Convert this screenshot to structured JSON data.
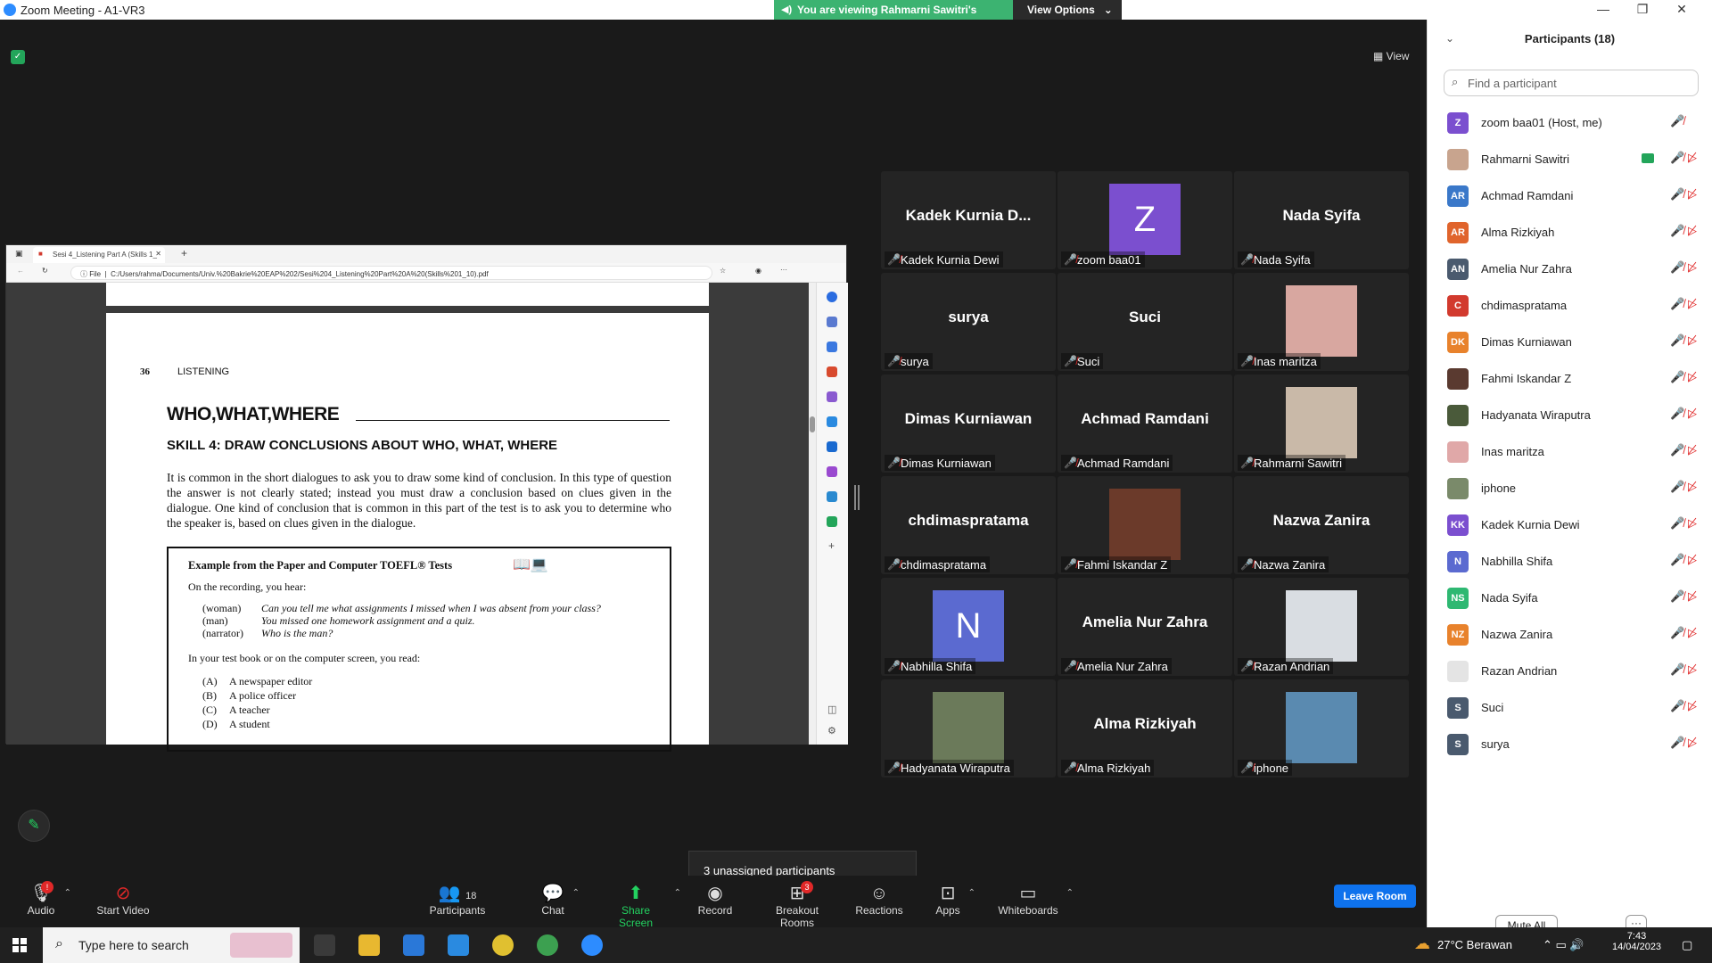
{
  "window": {
    "title": "Zoom Meeting - A1-VR3",
    "min": "—",
    "max": "❐",
    "close": "✕"
  },
  "banner": {
    "text": "You are viewing Rahmarni Sawitri's screen",
    "view_options": "View Options",
    "view": "View"
  },
  "share": {
    "tab_title": "Sesi 4_Listening Part A (Skills 1_",
    "url": "C:/Users/rahma/Documents/Univ.%20Bakrie%20EAP%202/Sesi%204_Listening%20Part%20A%20(Skills%201_10).pdf",
    "file_label": "File",
    "page_number": "36",
    "running_head": "LISTENING",
    "heading": "WHO,WHAT,WHERE",
    "skill": "SKILL 4:   DRAW CONCLUSIONS ABOUT WHO, WHAT, WHERE",
    "paragraph": "It is common in the short dialogues to ask you to draw some kind of conclusion. In this type of question the answer is not clearly stated; instead you must draw a conclusion based on clues given in the dialogue. One kind of conclusion that is common in this part of the test is to ask you to determine who the speaker is, based on clues given in the dialogue.",
    "example_title": "Example from the Paper and Computer TOEFL® Tests",
    "on_recording": "On the recording, you hear:",
    "dialogue": [
      {
        "who": "(woman)",
        "what": "Can you tell me what assignments I missed when I was absent from your class?"
      },
      {
        "who": "(man)",
        "what": "You missed one homework assignment and a quiz."
      },
      {
        "who": "(narrator)",
        "what": "Who is the man?"
      }
    ],
    "read_line": "In your test book or on the computer screen, you read:",
    "options": [
      {
        "key": "(A)",
        "text": "A newspaper editor"
      },
      {
        "key": "(B)",
        "text": "A police officer"
      },
      {
        "key": "(C)",
        "text": "A teacher"
      },
      {
        "key": "(D)",
        "text": "A student"
      }
    ]
  },
  "gallery": [
    {
      "center": "Kadek  Kurnia  D...",
      "label": "Kadek Kurnia Dewi"
    },
    {
      "avatar": "Z",
      "color": "#7b4fcf",
      "label": "zoom baa01"
    },
    {
      "center": "Nada Syifa",
      "label": "Nada Syifa"
    },
    {
      "center": "surya",
      "label": "surya"
    },
    {
      "center": "Suci",
      "label": "Suci"
    },
    {
      "photo": "#d8a7a0",
      "label": "Inas maritza"
    },
    {
      "center": "Dimas Kurniawan",
      "label": "Dimas Kurniawan"
    },
    {
      "center": "Achmad Ramdani",
      "label": "Achmad Ramdani"
    },
    {
      "photo": "#c9b9a8",
      "label": "Rahmarni Sawitri"
    },
    {
      "center": "chdimaspratama",
      "label": "chdimaspratama"
    },
    {
      "photo": "#6b3a2a",
      "label": "Fahmi Iskandar Z"
    },
    {
      "center": "Nazwa Zanira",
      "label": "Nazwa Zanira"
    },
    {
      "avatar": "N",
      "color": "#5b6ad0",
      "label": "Nabhilla Shifa"
    },
    {
      "center": "Amelia Nur Zahra",
      "label": "Amelia Nur Zahra"
    },
    {
      "photo": "#d9dde2",
      "label": "Razan Andrian"
    },
    {
      "photo": "#6b7a5a",
      "label": "Hadyanata Wiraputra"
    },
    {
      "center": "Alma Rizkiyah",
      "label": "Alma Rizkiyah"
    },
    {
      "photo": "#5a8ab0",
      "label": "iphone"
    }
  ],
  "unassigned": "3 unassigned participants",
  "toolbar": {
    "audio": "Audio",
    "start_video": "Start Video",
    "participants": "Participants",
    "participants_count": "18",
    "chat": "Chat",
    "share_screen": "Share Screen",
    "record": "Record",
    "breakout": "Breakout Rooms",
    "breakout_count": "3",
    "reactions": "Reactions",
    "apps": "Apps",
    "whiteboards": "Whiteboards",
    "leave": "Leave Room",
    "audio_badge": "!"
  },
  "panel": {
    "title": "Participants (18)",
    "search_placeholder": "Find a participant",
    "mute_all": "Mute All",
    "more": "···",
    "participants": [
      {
        "initials": "Z",
        "color": "#7b4fcf",
        "name": "zoom baa01 (Host, me)"
      },
      {
        "initials": "",
        "color": "#c8a48e",
        "name": "Rahmarni Sawitri",
        "sharing": true
      },
      {
        "initials": "AR",
        "color": "#3a78c9",
        "name": "Achmad Ramdani"
      },
      {
        "initials": "AR",
        "color": "#e0642c",
        "name": "Alma Rizkiyah"
      },
      {
        "initials": "AN",
        "color": "#4a5a6e",
        "name": "Amelia Nur Zahra"
      },
      {
        "initials": "C",
        "color": "#d23a2e",
        "name": "chdimaspratama"
      },
      {
        "initials": "DK",
        "color": "#e8822c",
        "name": "Dimas Kurniawan"
      },
      {
        "initials": "",
        "color": "#5a3a30",
        "name": "Fahmi Iskandar Z"
      },
      {
        "initials": "",
        "color": "#4a5a3a",
        "name": "Hadyanata Wiraputra"
      },
      {
        "initials": "",
        "color": "#e0a8a8",
        "name": "Inas maritza"
      },
      {
        "initials": "",
        "color": "#7a8a6a",
        "name": "iphone"
      },
      {
        "initials": "KK",
        "color": "#7b4fcf",
        "name": "Kadek Kurnia Dewi"
      },
      {
        "initials": "N",
        "color": "#5b6ad0",
        "name": "Nabhilla Shifa"
      },
      {
        "initials": "NS",
        "color": "#2eb872",
        "name": "Nada Syifa"
      },
      {
        "initials": "NZ",
        "color": "#e8822c",
        "name": "Nazwa Zanira"
      },
      {
        "initials": "",
        "color": "#e4e4e4",
        "name": "Razan Andrian"
      },
      {
        "initials": "S",
        "color": "#4a5a6e",
        "name": "Suci"
      },
      {
        "initials": "S",
        "color": "#4a5a6e",
        "name": "surya"
      }
    ]
  },
  "taskbar": {
    "search": "Type here to search",
    "weather": "27°C  Berawan",
    "time": "7:43",
    "date": "14/04/2023"
  }
}
